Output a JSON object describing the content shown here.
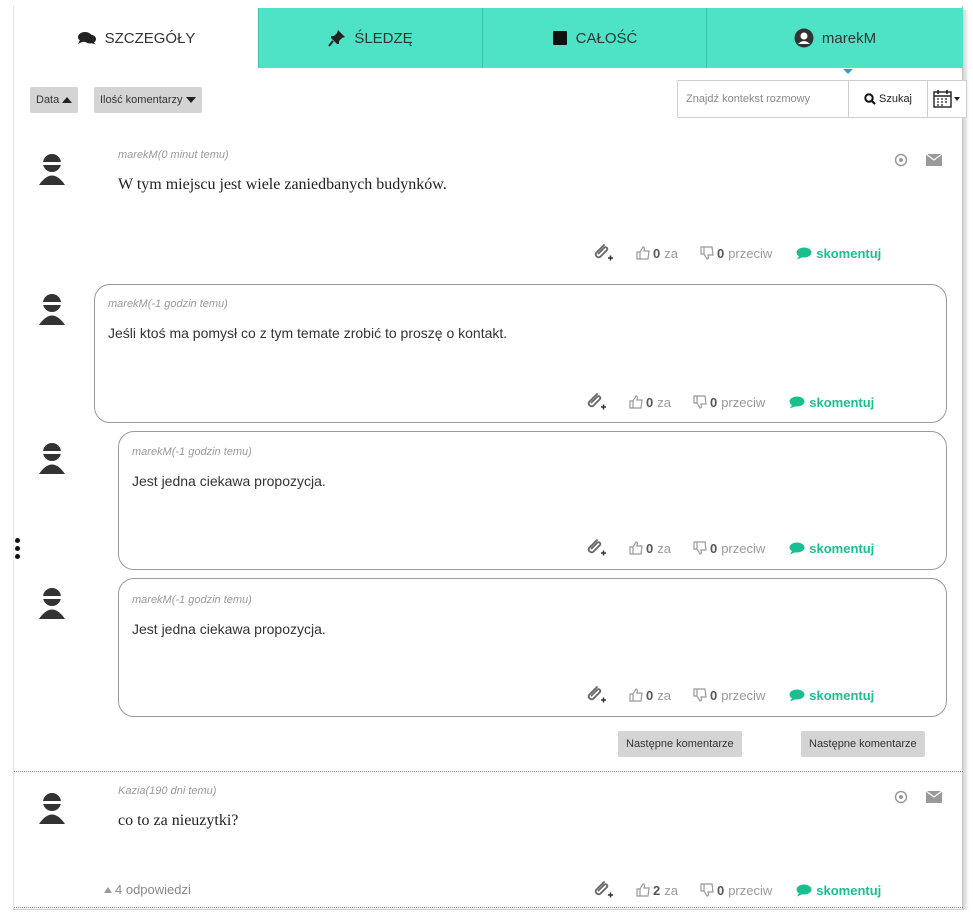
{
  "tabs": [
    {
      "label": "SZCZEGÓŁY",
      "icon": "comments-icon"
    },
    {
      "label": "ŚLEDZĘ",
      "icon": "pin-icon"
    },
    {
      "label": "CAŁOŚĆ",
      "icon": "square-icon"
    },
    {
      "label": "marekM",
      "icon": "user-icon"
    }
  ],
  "toolbar": {
    "sort_date_label": "Data",
    "sort_count_label": "Ilość komentarzy",
    "search_placeholder": "Znajdź kontekst rozmowy",
    "search_button_label": "Szukaj",
    "calendar_icon": "calendar-icon"
  },
  "comments": [
    {
      "meta": "marekM(0 minut temu)",
      "text": "W tym miejscu jest wiele zaniedbanych budynków.",
      "likes": "0",
      "likes_label": "za",
      "dislikes": "0",
      "dislikes_label": "przeciw",
      "reply_label": "skomentuj"
    },
    {
      "meta": "marekM(-1 godzin temu)",
      "text": "Jeśli ktoś ma pomysł co z tym temate zrobić to proszę o kontakt.",
      "likes": "0",
      "likes_label": "za",
      "dislikes": "0",
      "dislikes_label": "przeciw",
      "reply_label": "skomentuj"
    },
    {
      "meta": "marekM(-1 godzin temu)",
      "text": "Jest jedna ciekawa propozycja.",
      "likes": "0",
      "likes_label": "za",
      "dislikes": "0",
      "dislikes_label": "przeciw",
      "reply_label": "skomentuj"
    },
    {
      "meta": "marekM(-1 godzin temu)",
      "text": "Jest jedna ciekawa propozycja.",
      "likes": "0",
      "likes_label": "za",
      "dislikes": "0",
      "dislikes_label": "przeciw",
      "reply_label": "skomentuj"
    },
    {
      "meta": "Kazia(190 dni temu)",
      "text": "co to za nieuzytki?",
      "likes": "2",
      "likes_label": "za",
      "dislikes": "0",
      "dislikes_label": "przeciw",
      "reply_label": "skomentuj",
      "replies_label": "4 odpowiedzi"
    }
  ],
  "more_buttons": [
    "Następne komentarze",
    "Następne komentarze"
  ],
  "colors": {
    "tab_accent": "#4ee3c6",
    "reply_green": "#1bbf8f",
    "caret_blue": "#3a9bd0"
  }
}
